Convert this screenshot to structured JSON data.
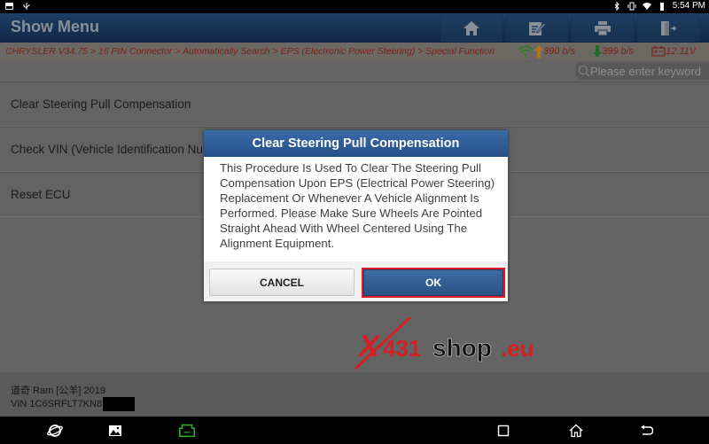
{
  "status_bar": {
    "left_icons": [
      "image-notification-icon",
      "usb-icon"
    ],
    "right_icons": [
      "bluetooth-icon",
      "vibrate-icon",
      "wifi-icon",
      "battery-icon"
    ],
    "time": "5:54 PM"
  },
  "app_bar": {
    "title": "Show Menu",
    "toolbar": [
      {
        "name": "home",
        "icon": "home-icon"
      },
      {
        "name": "edit-report",
        "icon": "edit-icon"
      },
      {
        "name": "print",
        "icon": "print-icon"
      },
      {
        "name": "exit",
        "icon": "exit-icon"
      }
    ]
  },
  "breadcrumb": {
    "path": "CHRYSLER V34.75 > 16 PIN Connector > Automatically Search > EPS (Electronic Power Steering) > Special Function",
    "upload_rate": "390 b/s",
    "download_rate": "399 b/s",
    "battery_voltage": "12.11V"
  },
  "search": {
    "placeholder": "Please enter keyword",
    "value": ""
  },
  "menu": {
    "items": [
      {
        "label": "Clear Steering Pull Compensation"
      },
      {
        "label": "Check VIN (Vehicle Identification Number)"
      },
      {
        "label": "Reset ECU"
      }
    ]
  },
  "dialog": {
    "title": "Clear Steering Pull Compensation",
    "message": "This Procedure Is Used To Clear The Steering Pull Compensation Upon EPS (Electrical Power Steering) Replacement Or Whenever A Vehicle Alignment Is Performed.  Please Make Sure Wheels Are Pointed Straight Ahead With Wheel Centered Using The Alignment Equipment.",
    "cancel_label": "CANCEL",
    "ok_label": "OK"
  },
  "vehicle": {
    "model": "道奇 Ram [公羊] 2019",
    "vin": "VIN 1C6SRFLT7KN8"
  },
  "watermark": {
    "x": "X",
    "num": "431",
    "shop": "shop",
    "tld": ".eu"
  },
  "colors": {
    "breadcrumb_text": "#7a2418",
    "dialog_header": "#2f5d97",
    "highlight_border": "#e21b24",
    "vci_green": "#2db82d",
    "upload_arrow": "#d58a12",
    "download_arrow": "#1f8a2a"
  },
  "nav_bar": {
    "buttons": [
      "browser-icon",
      "gallery-icon",
      "vci-icon",
      "recent-apps-icon",
      "home-icon",
      "back-icon"
    ]
  }
}
